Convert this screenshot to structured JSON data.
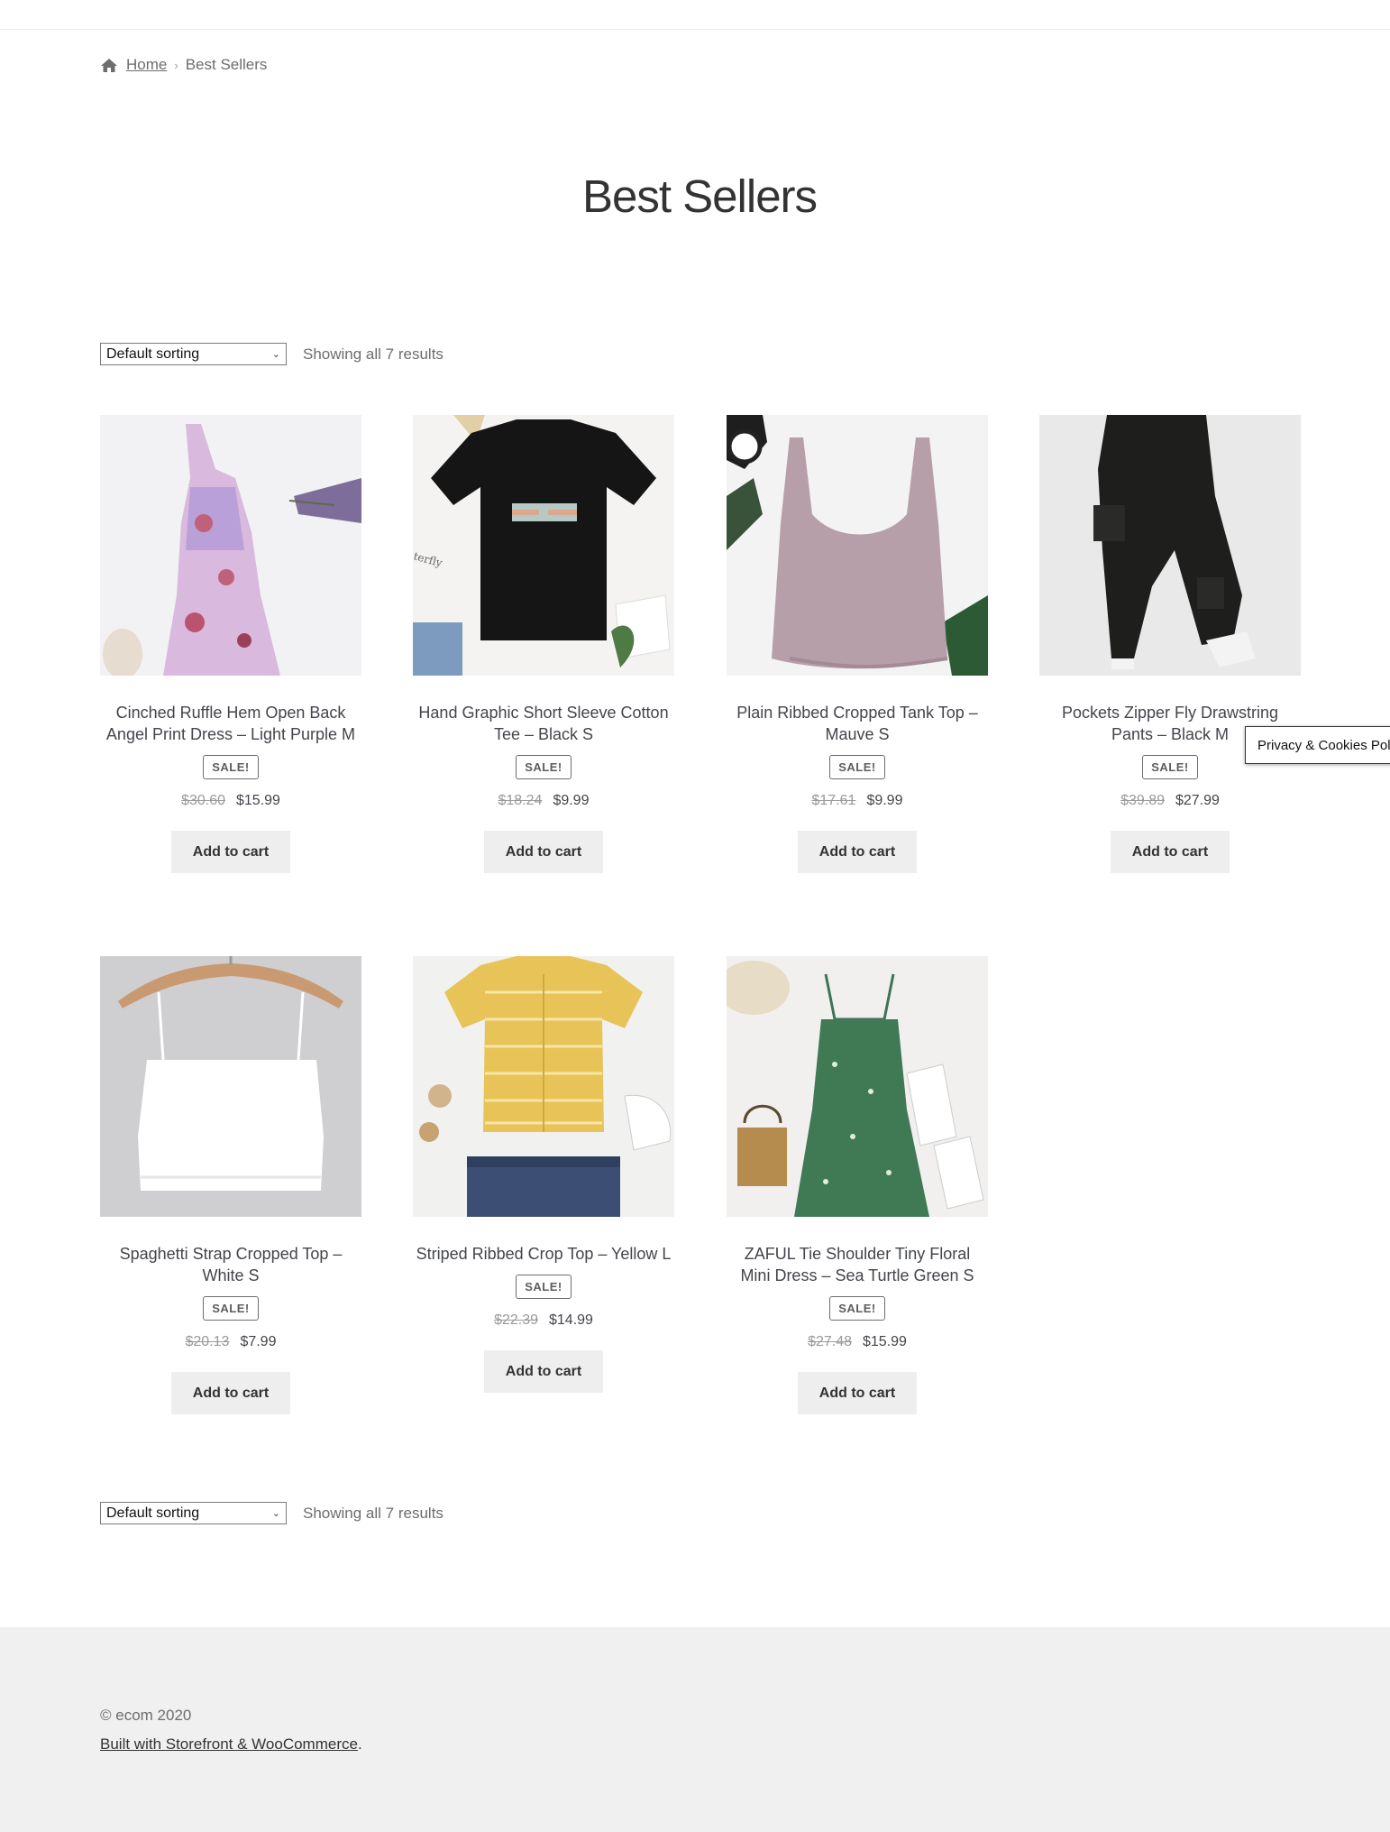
{
  "breadcrumb": {
    "home": "Home",
    "separator": "›",
    "current": "Best Sellers"
  },
  "page_title": "Best Sellers",
  "toolbar": {
    "sort_value": "Default sorting",
    "result_count": "Showing all 7 results"
  },
  "sale_badge": "SALE!",
  "add_to_cart": "Add to cart",
  "products": [
    {
      "title": "Cinched Ruffle Hem Open Back Angel Print Dress – Light Purple M",
      "old_price": "$30.60",
      "price": "$15.99",
      "on_sale": true
    },
    {
      "title": "Hand Graphic Short Sleeve Cotton Tee – Black S",
      "old_price": "$18.24",
      "price": "$9.99",
      "on_sale": true
    },
    {
      "title": "Plain Ribbed Cropped Tank Top – Mauve S",
      "old_price": "$17.61",
      "price": "$9.99",
      "on_sale": true
    },
    {
      "title": "Pockets Zipper Fly Drawstring Pants – Black M",
      "old_price": "$39.89",
      "price": "$27.99",
      "on_sale": true
    },
    {
      "title": "Spaghetti Strap Cropped Top – White S",
      "old_price": "$20.13",
      "price": "$7.99",
      "on_sale": true
    },
    {
      "title": "Striped Ribbed Crop Top – Yellow L",
      "old_price": "$22.39",
      "price": "$14.99",
      "on_sale": true
    },
    {
      "title": "ZAFUL Tie Shoulder Tiny Floral Mini Dress – Sea Turtle Green S",
      "old_price": "$27.48",
      "price": "$15.99",
      "on_sale": true
    }
  ],
  "privacy_tab": "Privacy & Cookies Pol",
  "footer": {
    "copyright": "© ecom 2020",
    "credit_link": "Built with Storefront & WooCommerce",
    "credit_suffix": "."
  },
  "colors": {
    "text": "#43454b",
    "muted": "#6d6d6d",
    "button_bg": "#eeeeee",
    "footer_bg": "#f0f0f0"
  }
}
